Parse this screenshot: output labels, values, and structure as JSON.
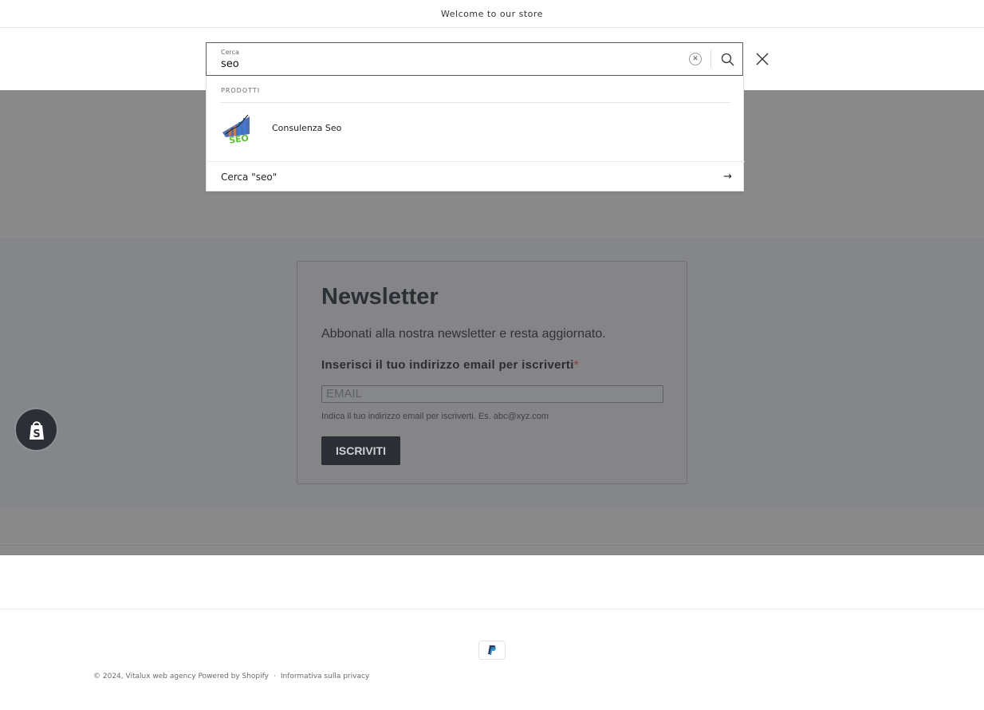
{
  "announcement": {
    "text": "Welcome to our store"
  },
  "search": {
    "label": "Cerca",
    "value": "seo",
    "clear_icon": "close-circle-icon",
    "search_icon": "search-icon",
    "close_icon": "close-icon"
  },
  "predictive": {
    "heading": "PRODOTTI",
    "products": [
      {
        "name": "Consulenza Seo",
        "image": "seo-chart-thumbnail"
      }
    ],
    "search_for_text": "Cerca \"seo\"",
    "arrow_icon": "arrow-right-icon"
  },
  "newsletter": {
    "title": "Newsletter",
    "subtitle": "Abbonati alla nostra newsletter e resta aggiornato.",
    "field_label": "Inserisci il tuo indirizzo email per iscriverti",
    "required_mark": "*",
    "email_placeholder": "EMAIL",
    "hint": "Indica il tuo indirizzo email per iscriverti. Es. abc@xyz.com",
    "button_label": "ISCRIVITI"
  },
  "badges": {
    "shopify": "shopify-bag-icon",
    "payment": "paypal-icon"
  },
  "footer": {
    "copyright": "© 2024, Vitalux web agency Powered by Shopify",
    "separator": "·",
    "privacy": "Informativa sulla privacy"
  },
  "colors": {
    "overlay": "#8a8a8a",
    "newsletter_bg": "#85868a",
    "button_bg": "#2b2e35",
    "badge_bg": "#2c3036"
  }
}
